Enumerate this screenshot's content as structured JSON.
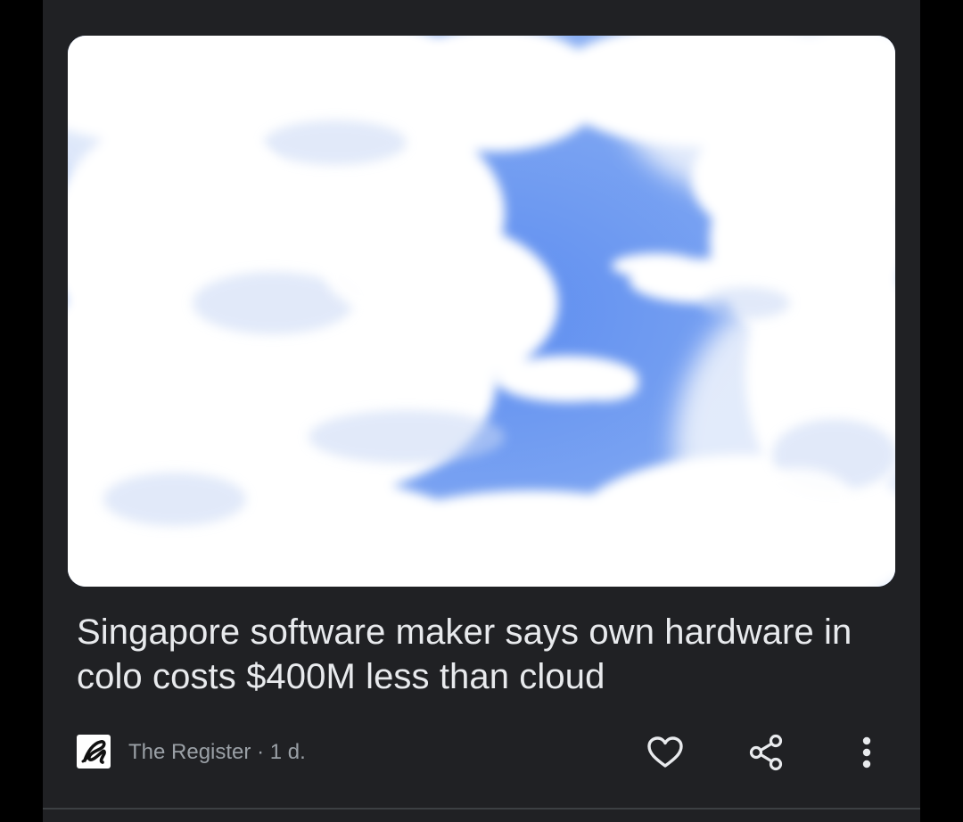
{
  "article": {
    "headline": "Singapore software maker says own hardware in colo costs $400M less than cloud",
    "image_alt": "Clouds parting to reveal a blue sky shaped like a dollar sign",
    "source_name": "The Register",
    "separator": "·",
    "age": "1 d."
  },
  "actions": {
    "like_icon": "heart-icon",
    "share_icon": "share-icon",
    "more_icon": "more-vert-icon"
  },
  "colors": {
    "card_background": "#202124",
    "page_background": "#000000",
    "headline_text": "#e8eaed",
    "meta_text": "#9aa0a6",
    "sky_blue": "#6f9cf0"
  }
}
